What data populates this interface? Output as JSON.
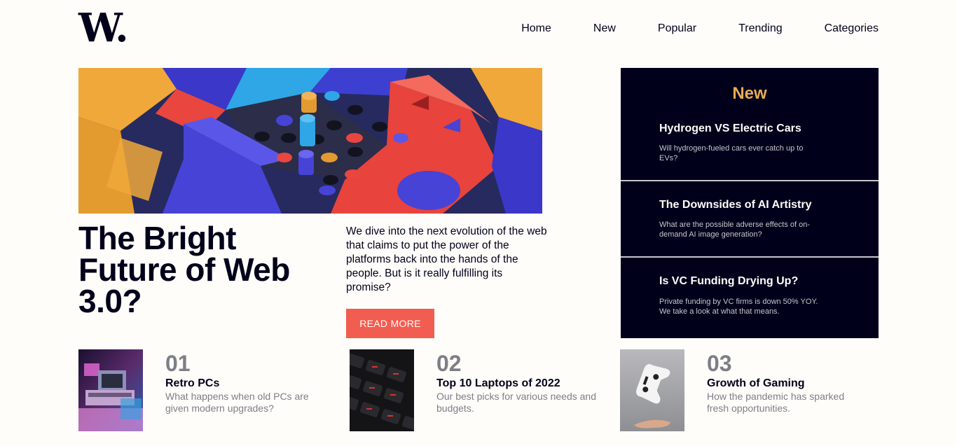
{
  "brand": {
    "logo": "W."
  },
  "nav": {
    "items": [
      "Home",
      "New",
      "Popular",
      "Trending",
      "Categories"
    ]
  },
  "hero": {
    "image": "abstract-3d-blocks-illustration",
    "title": "The Bright Future of Web 3.0?",
    "lede": "We dive into the next evolution of the web that claims to put the power of the platforms back into the hands of the people. But is it really fulfilling its promise?",
    "cta": "READ MORE"
  },
  "new_panel": {
    "title": "New",
    "items": [
      {
        "title": "Hydrogen VS Electric Cars",
        "desc": "Will hydrogen-fueled cars ever catch up to EVs?"
      },
      {
        "title": "The Downsides of AI Artistry",
        "desc": "What are the possible adverse effects of on-demand AI image generation?"
      },
      {
        "title": "Is VC Funding Drying Up?",
        "desc": "Private funding by VC firms is down 50% YOY. We take a look at what that means."
      }
    ]
  },
  "cards": [
    {
      "number": "01",
      "title": "Retro PCs",
      "desc": "What happens when old PCs are given modern upgrades?",
      "image": "retro-pc-photo"
    },
    {
      "number": "02",
      "title": "Top 10 Laptops of 2022",
      "desc": "Our best picks for various needs and budgets.",
      "image": "laptop-keyboard-photo"
    },
    {
      "number": "03",
      "title": "Growth of Gaming",
      "desc": "How the pandemic has sparked fresh opportunities.",
      "image": "game-controller-photo"
    }
  ],
  "colors": {
    "dark_navy": "#00001a",
    "off_white": "#fffdfa",
    "soft_red": "#f15d51",
    "soft_orange": "#e9ab53",
    "grayish_blue": "#c5c6ce",
    "dark_grayish_blue": "#7d7e86"
  }
}
